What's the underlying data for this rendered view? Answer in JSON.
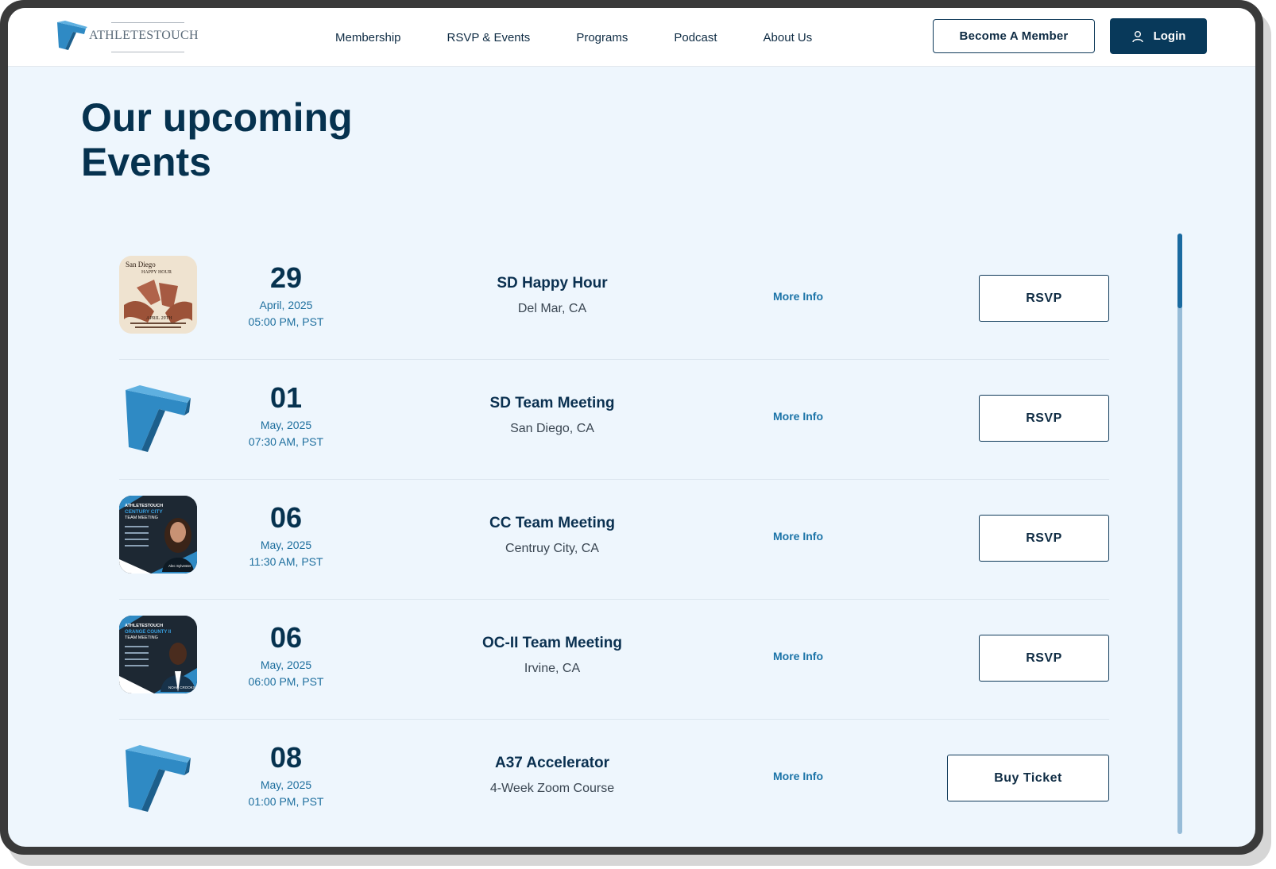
{
  "brand": {
    "name": "AthletesTouch"
  },
  "nav": {
    "items": [
      "Membership",
      "RSVP & Events",
      "Programs",
      "Podcast",
      "About Us"
    ]
  },
  "header": {
    "become_member": "Become A Member",
    "login": "Login"
  },
  "page": {
    "title_line1": "Our upcoming",
    "title_line2": "Events"
  },
  "events": [
    {
      "day": "29",
      "month": "April, 2025",
      "time": "05:00 PM, PST",
      "title": "SD Happy Hour",
      "location": "Del Mar, CA",
      "more": "More Info",
      "action": "RSVP",
      "poster": {
        "line1": "San Diego",
        "line2": "HAPPY HOUR",
        "line3": "APRIL 29TH"
      }
    },
    {
      "day": "01",
      "month": "May, 2025",
      "time": "07:30 AM, PST",
      "title": "SD Team Meeting",
      "location": "San Diego, CA",
      "more": "More Info",
      "action": "RSVP"
    },
    {
      "day": "06",
      "month": "May, 2025",
      "time": "11:30 AM, PST",
      "title": "CC Team Meeting",
      "location": "Centruy City, CA",
      "more": "More Info",
      "action": "RSVP",
      "poster": {
        "brand": "ATHLETESTOUCH",
        "region": "CENTURY CITY",
        "kind": "TEAM MEETING",
        "host": "Alec Sylvester"
      }
    },
    {
      "day": "06",
      "month": "May, 2025",
      "time": "06:00 PM, PST",
      "title": "OC-II Team Meeting",
      "location": "Irvine, CA",
      "more": "More Info",
      "action": "RSVP",
      "poster": {
        "brand": "ATHLETESTOUCH",
        "region": "ORANGE COUNTY II",
        "kind": "TEAM MEETING",
        "host": "NOAH CROOKS"
      }
    },
    {
      "day": "08",
      "month": "May, 2025",
      "time": "01:00 PM, PST",
      "title": "A37 Accelerator",
      "location": "4-Week Zoom Course",
      "more": "More Info",
      "action": "Buy Ticket"
    }
  ],
  "colors": {
    "primary": "#06324f",
    "accent": "#1c74a8",
    "background": "#eef6fd",
    "logo_blue": "#2f8ac4"
  }
}
